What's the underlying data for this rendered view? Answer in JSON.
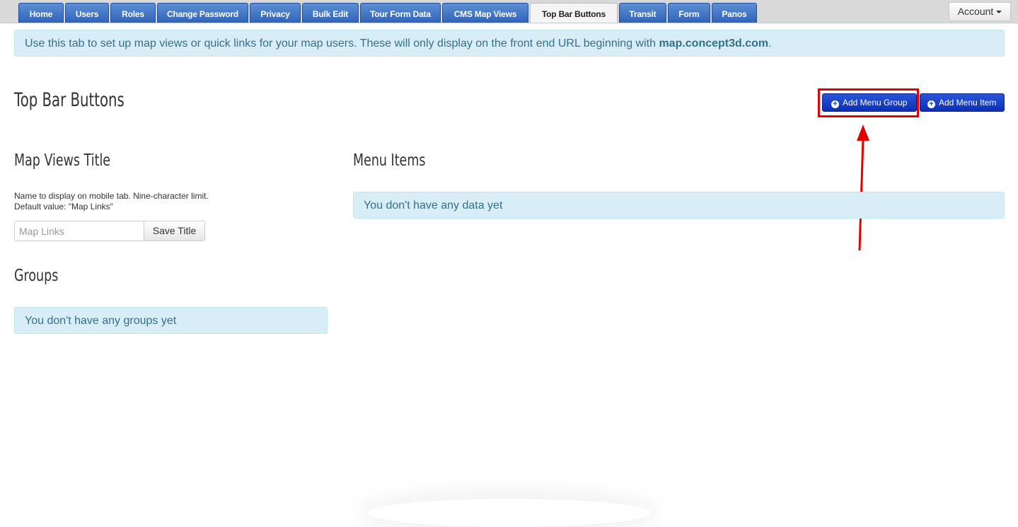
{
  "nav": {
    "tabs": [
      {
        "label": "Home"
      },
      {
        "label": "Users"
      },
      {
        "label": "Roles"
      },
      {
        "label": "Change Password"
      },
      {
        "label": "Privacy"
      },
      {
        "label": "Bulk Edit"
      },
      {
        "label": "Tour Form Data"
      },
      {
        "label": "CMS Map Views"
      },
      {
        "label": "Top Bar Buttons"
      },
      {
        "label": "Transit"
      },
      {
        "label": "Form"
      },
      {
        "label": "Panos"
      }
    ],
    "active_tab": "Top Bar Buttons",
    "account_label": "Account"
  },
  "info_banner": {
    "text": "Use this tab to set up map views or quick links for your map users. These will only display on the front end URL beginning with ",
    "link_text": "map.concept3d.com",
    "suffix": "."
  },
  "page": {
    "title": "Top Bar Buttons",
    "add_menu_group_label": "Add Menu Group",
    "add_menu_item_label": "Add Menu Item"
  },
  "map_views": {
    "title": "Map Views Title",
    "help_line1": "Name to display on mobile tab. Nine-character limit.",
    "help_line2": "Default value: \"Map Links\"",
    "input_placeholder": "Map Links",
    "save_label": "Save Title"
  },
  "groups": {
    "title": "Groups",
    "empty_text": "You don't have any groups yet"
  },
  "menu_items": {
    "title": "Menu Items",
    "empty_text": "You don't have any data yet"
  },
  "colors": {
    "tab_blue": "#2f63b8",
    "info_bg": "#d9edf7",
    "info_text": "#31708f",
    "button_blue": "#0b2fb4",
    "annotation_red": "#e20000"
  }
}
